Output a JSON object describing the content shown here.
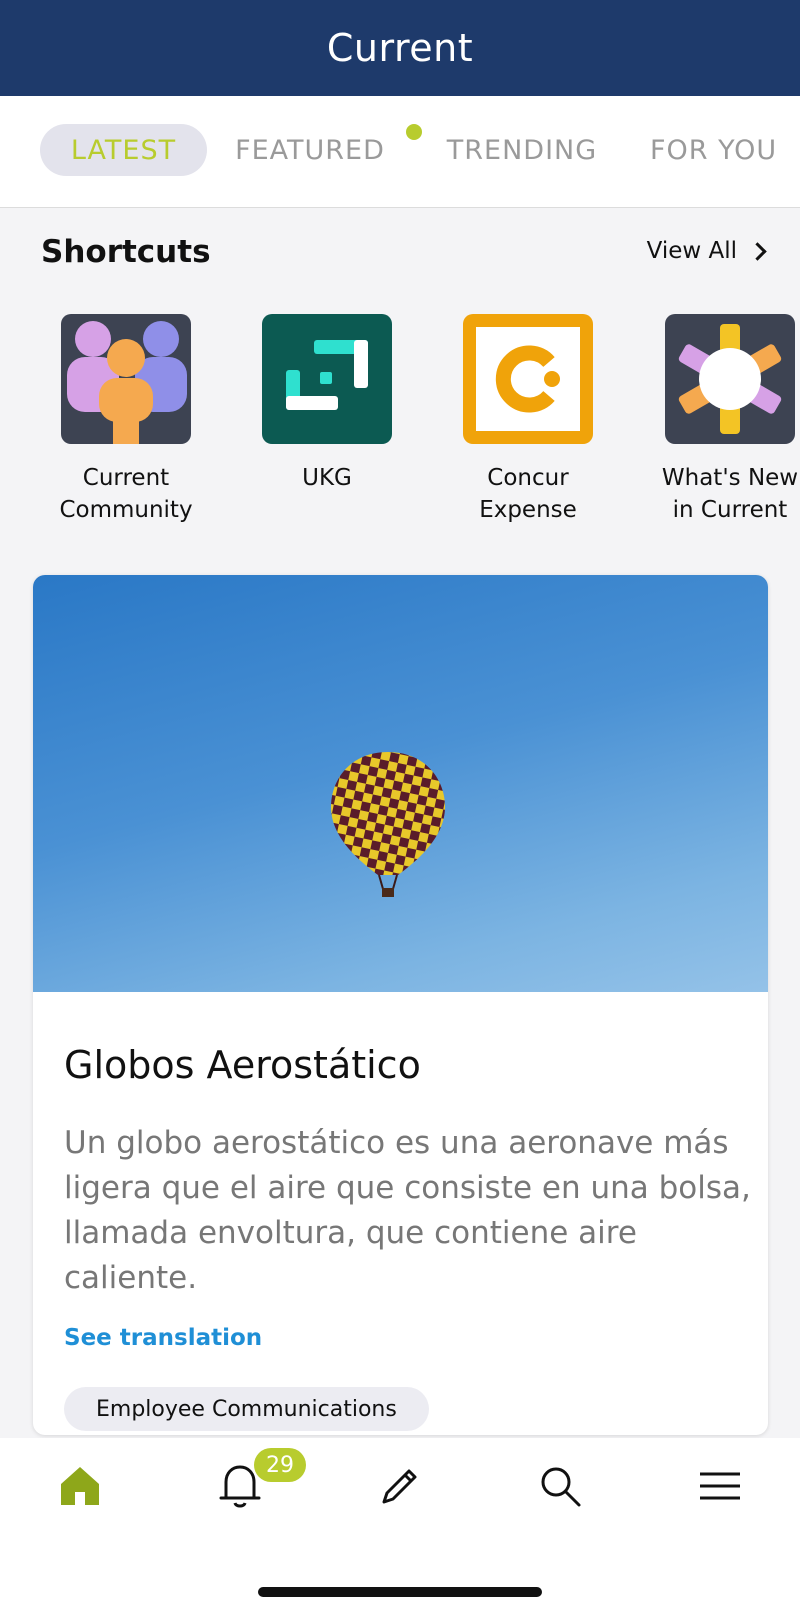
{
  "header": {
    "title": "Current"
  },
  "tabs": [
    {
      "label": "LATEST",
      "active": true
    },
    {
      "label": "FEATURED",
      "active": false,
      "has_dot": true
    },
    {
      "label": "TRENDING",
      "active": false
    },
    {
      "label": "FOR YOU",
      "active": false
    }
  ],
  "shortcuts": {
    "title": "Shortcuts",
    "view_all": "View All",
    "items": [
      {
        "label": "Current\nCommunity",
        "icon": "people-group-icon"
      },
      {
        "label": "UKG",
        "icon": "ukg-logo-icon"
      },
      {
        "label": "Concur\nExpense",
        "icon": "concur-logo-icon"
      },
      {
        "label": "What's New\nin Current",
        "icon": "sparkle-icon"
      }
    ]
  },
  "post": {
    "image": "hot-air-balloon-image",
    "title": "Globos Aerostático",
    "text": "Un globo aerostático es una aeronave más ligera que el aire que consiste en una bolsa, llamada envoltura, que contiene aire caliente.",
    "see_translation": "See translation",
    "tag": "Employee Communications"
  },
  "bottom_nav": {
    "items": [
      "home-icon",
      "bell-icon",
      "pencil-icon",
      "search-icon",
      "menu-icon"
    ],
    "notification_count": "29"
  },
  "colors": {
    "header_bg": "#1e3a6b",
    "accent": "#b8cc2e",
    "link": "#1f8fd6"
  }
}
